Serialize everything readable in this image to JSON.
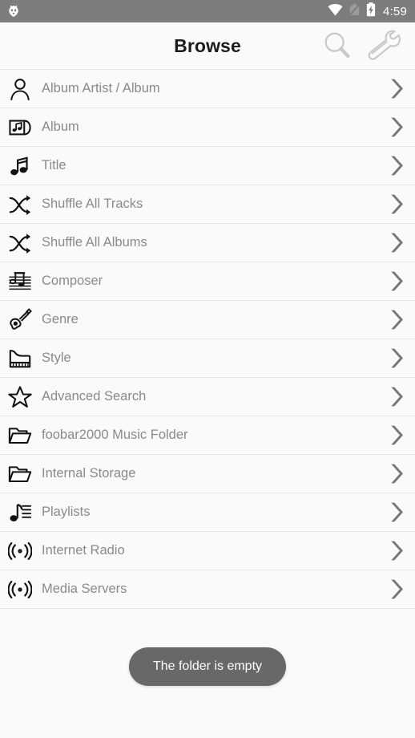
{
  "status_bar": {
    "app_logo_name": "foobar2000-logo",
    "wifi_icon": "wifi-icon",
    "signal_icon": "no-sim-signal-icon",
    "battery_icon": "battery-charging-icon",
    "time": "4:59",
    "background_color": "#7d7d7d",
    "text_color": "#ffffff"
  },
  "action_bar": {
    "title": "Browse",
    "actions": [
      {
        "name": "search-icon",
        "label": "Search"
      },
      {
        "name": "wrench-icon",
        "label": "Settings"
      }
    ]
  },
  "list": {
    "chevron_icon": "chevron-right-icon",
    "items": [
      {
        "label": "Album Artist / Album",
        "icon": "person-icon"
      },
      {
        "label": "Album",
        "icon": "album-icon"
      },
      {
        "label": "Title",
        "icon": "music-note-icon"
      },
      {
        "label": "Shuffle All Tracks",
        "icon": "shuffle-icon"
      },
      {
        "label": "Shuffle All Albums",
        "icon": "shuffle-icon"
      },
      {
        "label": "Composer",
        "icon": "music-staff-icon"
      },
      {
        "label": "Genre",
        "icon": "guitar-icon"
      },
      {
        "label": "Style",
        "icon": "piano-icon"
      },
      {
        "label": "Advanced Search",
        "icon": "star-icon"
      },
      {
        "label": "foobar2000 Music Folder",
        "icon": "folder-icon"
      },
      {
        "label": "Internal Storage",
        "icon": "folder-icon"
      },
      {
        "label": "Playlists",
        "icon": "playlist-note-icon"
      },
      {
        "label": "Internet Radio",
        "icon": "radio-waves-icon"
      },
      {
        "label": "Media Servers",
        "icon": "radio-waves-icon"
      }
    ]
  },
  "toast": {
    "message": "The folder is empty",
    "background_color": "#686868",
    "text_color": "#ffffff"
  },
  "theme": {
    "page_background": "#fafafa",
    "separator": "#e4e4e4",
    "label_color": "#8a8a8a",
    "icon_color": "#121212",
    "chevron_color": "#777777",
    "title_color": "#1c1c1c"
  }
}
